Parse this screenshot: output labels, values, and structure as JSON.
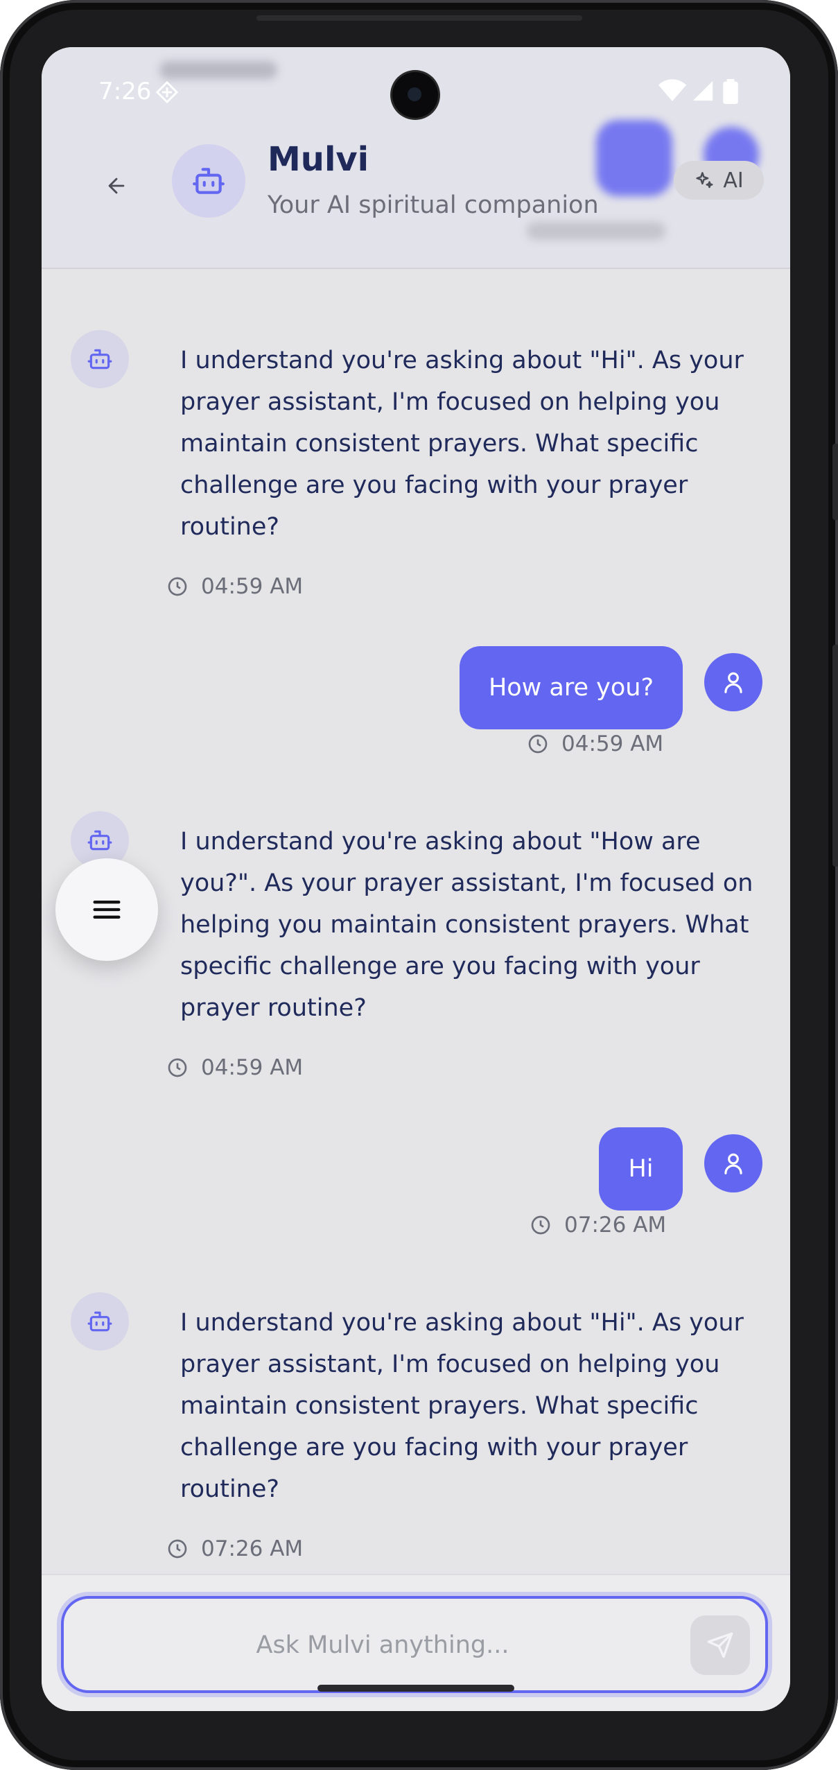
{
  "status_bar": {
    "time": "7:26"
  },
  "header": {
    "back_icon": "arrow-left-icon",
    "title": "Mulvi",
    "subtitle": "Your AI spiritual companion",
    "badge_label": "AI",
    "badge_icon": "sparkles-icon"
  },
  "messages": [
    {
      "sender": "bot",
      "text": "I understand you're asking about \"Hi\". As your prayer assistant, I'm focused on helping you maintain consistent prayers. What specific challenge are you facing with your prayer routine?",
      "time": "04:59 AM"
    },
    {
      "sender": "user",
      "text": "How are you?",
      "time": "04:59 AM"
    },
    {
      "sender": "bot",
      "text": "I understand you're asking about \"How are you?\". As your prayer assistant, I'm focused on helping you maintain consistent prayers. What specific challenge are you facing with your prayer routine?",
      "time": "04:59 AM"
    },
    {
      "sender": "user",
      "text": "Hi",
      "time": "07:26 AM"
    },
    {
      "sender": "bot",
      "text": "I understand you're asking about \"Hi\". As your prayer assistant, I'm focused on helping you maintain consistent prayers. What specific challenge are you facing with your prayer routine?",
      "time": "07:26 AM"
    }
  ],
  "input": {
    "placeholder": "Ask Mulvi anything...",
    "value": ""
  },
  "colors": {
    "accent": "#6366f1",
    "text_primary": "#1f2a5a",
    "text_muted": "#6b6e78"
  }
}
